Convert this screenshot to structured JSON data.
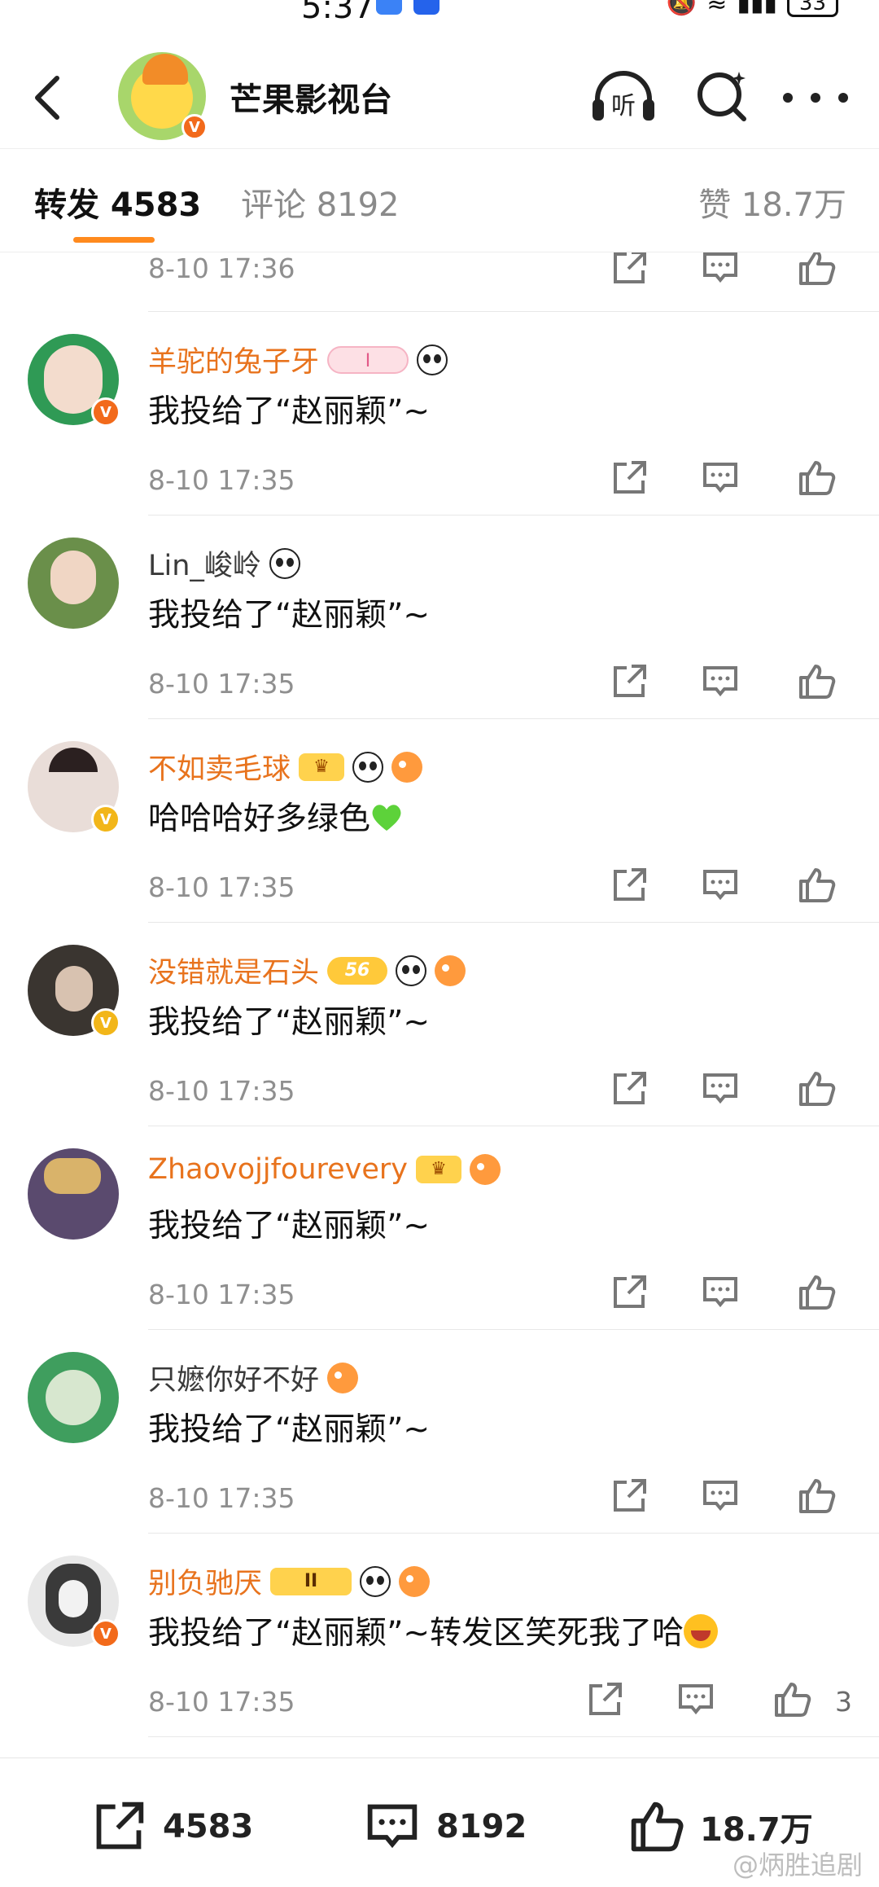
{
  "status_bar": {
    "time": "5:37",
    "battery": "33"
  },
  "header": {
    "title": "芒果影视台"
  },
  "tabs": {
    "repost": "转发 4583",
    "comment": "评论 8192",
    "like": "赞 18.7万"
  },
  "top_time": "8-10 17:36",
  "reposts": [
    {
      "name": "羊驼的兔子牙",
      "text": "我投给了“赵丽颖”~",
      "time": "8-10 17:35",
      "badge": "I"
    },
    {
      "name": "Lin_峻岭",
      "text": "我投给了“赵丽颖”~",
      "time": "8-10 17:35"
    },
    {
      "name": "不如卖毛球",
      "text": "哈哈哈好多绿色",
      "time": "8-10 17:35"
    },
    {
      "name": "没错就是石头",
      "text": "我投给了“赵丽颖”~",
      "time": "8-10 17:35",
      "badge": "56"
    },
    {
      "name": "Zhaovojjfourevery",
      "text": "我投给了“赵丽颖”~",
      "time": "8-10 17:35"
    },
    {
      "name": "只嬷你好不好",
      "text": "我投给了“赵丽颖”~",
      "time": "8-10 17:35"
    },
    {
      "name": "别负驰厌",
      "text": "我投给了“赵丽颖”~转发区笑死我了哈",
      "time": "8-10 17:35",
      "badge": "II",
      "like_count": "3"
    }
  ],
  "bottom_bar": {
    "repost": "4583",
    "comment": "8192",
    "like": "18.7万"
  },
  "watermark": "@炳胜追剧",
  "colors": {
    "accent": "#ff8a1e",
    "name_orange": "#e8731d",
    "verified_orange": "#f26a1b",
    "verified_gold": "#f2b619"
  },
  "icons": [
    "back-arrow-icon",
    "listen-icon",
    "search-icon",
    "more-icon",
    "repost-icon",
    "comment-icon",
    "like-icon",
    "verified-icon",
    "panda-emoji-icon",
    "fish-emoji-icon",
    "heart-emoji-icon",
    "laugh-emoji-icon"
  ]
}
